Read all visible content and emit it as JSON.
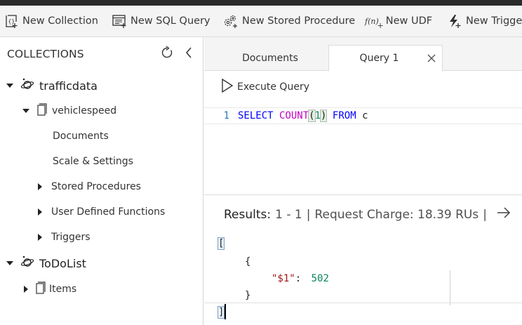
{
  "toolbar": {
    "new_collection": "New Collection",
    "new_sql_query": "New SQL Query",
    "new_stored_procedure": "New Stored Procedure",
    "udf_glyph": "f(n)",
    "udf_plus": "+",
    "new_udf": "New UDF",
    "new_trigger": "New Trigger"
  },
  "sidebar": {
    "title": "COLLECTIONS",
    "databases": [
      {
        "name": "trafficdata",
        "expanded": true,
        "collections": [
          {
            "name": "vehiclespeed",
            "expanded": true,
            "items": [
              "Documents",
              "Scale & Settings"
            ],
            "groups": [
              "Stored Procedures",
              "User Defined Functions",
              "Triggers"
            ]
          }
        ]
      },
      {
        "name": "ToDoList",
        "expanded": true,
        "collections": [
          {
            "name": "Items",
            "expanded": false
          }
        ]
      }
    ]
  },
  "tabs": [
    {
      "label": "Documents",
      "active": false
    },
    {
      "label": "Query 1",
      "active": true
    }
  ],
  "command": {
    "execute_label": "Execute Query"
  },
  "editor": {
    "line_number": "1",
    "tokens": {
      "select": "SELECT",
      "count": "COUNT",
      "open_paren": "(",
      "arg": "1",
      "close_paren": ")",
      "from": "FROM",
      "alias": "c"
    }
  },
  "results": {
    "label": "Results:",
    "range": "1 - 1",
    "separator": "|",
    "charge": "Request Charge: 18.39 RUs",
    "lines": {
      "open_bracket": "[",
      "open_brace": "{",
      "key": "\"$1\"",
      "colon": ":",
      "value": "502",
      "close_brace": "}",
      "close_bracket": "]"
    }
  },
  "colors": {
    "keyword": "#0000ff",
    "function": "#c000c0",
    "number": "#098658",
    "json_key": "#a31515",
    "line_number": "#2a79b0",
    "toolbar_bg": "#f4f4f4"
  }
}
